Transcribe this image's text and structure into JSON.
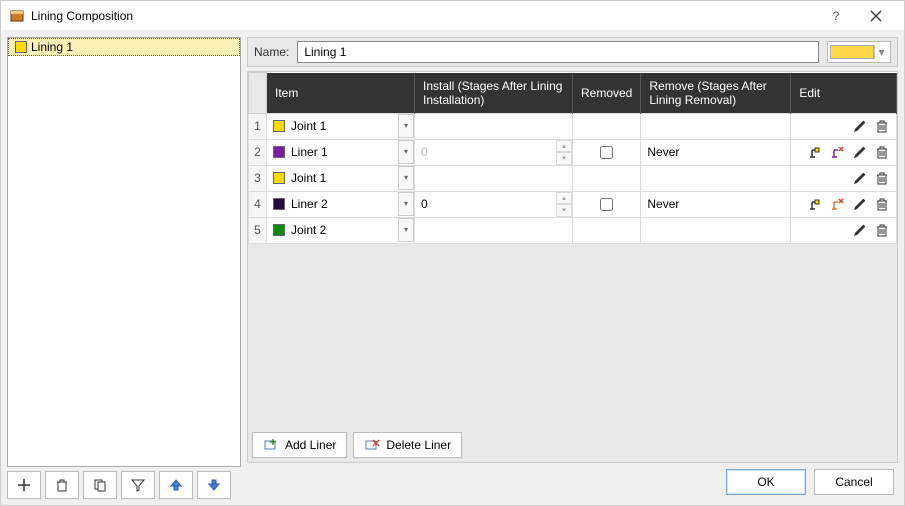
{
  "window": {
    "title": "Lining Composition"
  },
  "tree": {
    "items": [
      {
        "label": "Lining 1",
        "color": "#ffd800"
      }
    ]
  },
  "leftToolbar": {
    "add": "+",
    "delete": "del",
    "copy": "cpy",
    "filter": "flt",
    "up": "up",
    "down": "dn"
  },
  "name": {
    "label": "Name:",
    "value": "Lining 1",
    "color": "#ffd84a"
  },
  "grid": {
    "headers": {
      "item": "Item",
      "install": "Install (Stages After Lining Installation)",
      "removed": "Removed",
      "remove": "Remove (Stages After Lining Removal)",
      "edit": "Edit"
    },
    "rows": [
      {
        "n": "1",
        "color": "#ffd800",
        "name": "Joint 1",
        "install": "",
        "removedCheckbox": false,
        "remove": "",
        "icons": [
          "pencil",
          "trash"
        ],
        "installEditable": false
      },
      {
        "n": "2",
        "color": "#7b1fa2",
        "name": "Liner 1",
        "install": "0",
        "removedCheckbox": true,
        "remove": "Never",
        "icons": [
          "pile-yellow",
          "pile-purple",
          "pencil",
          "trash"
        ],
        "installEditable": true,
        "installDim": true
      },
      {
        "n": "3",
        "color": "#ffd800",
        "name": "Joint 1",
        "install": "",
        "removedCheckbox": false,
        "remove": "",
        "icons": [
          "pencil",
          "trash"
        ],
        "installEditable": false
      },
      {
        "n": "4",
        "color": "#2a0a3a",
        "name": "Liner 2",
        "install": "0",
        "removedCheckbox": true,
        "remove": "Never",
        "icons": [
          "pile-yellow",
          "pile-orange",
          "pencil",
          "trash"
        ],
        "installEditable": true,
        "installDim": false
      },
      {
        "n": "5",
        "color": "#0d8a0d",
        "name": "Joint 2",
        "install": "",
        "removedCheckbox": false,
        "remove": "",
        "icons": [
          "pencil",
          "trash"
        ],
        "installEditable": false
      }
    ]
  },
  "rowButtons": {
    "add": "Add Liner",
    "del": "Delete Liner"
  },
  "footer": {
    "ok": "OK",
    "cancel": "Cancel"
  }
}
